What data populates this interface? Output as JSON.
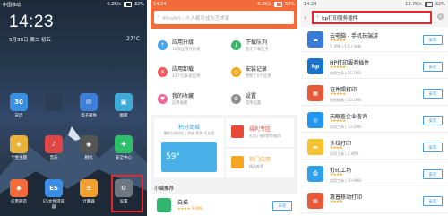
{
  "panel1": {
    "status": {
      "left": "中国移动",
      "right": "32%",
      "speed": "0.2K/s"
    },
    "clock": "14:23",
    "date": "5月30日 周二 初五",
    "temp": "27°C",
    "apps_row1": [
      {
        "label": "日历",
        "color": "#3a8fe0",
        "glyph": "30",
        "icon": "calendar-icon"
      },
      {
        "label": "",
        "color": "#2c3e55",
        "glyph": "",
        "icon": "app-icon"
      },
      {
        "label": "电子邮件",
        "color": "#3d7fd6",
        "glyph": "✉",
        "icon": "mail-icon"
      },
      {
        "label": "图库",
        "color": "#3fa9d8",
        "glyph": "▣",
        "icon": "gallery-icon"
      }
    ],
    "apps_row2": [
      {
        "label": "个性主题",
        "color": "#e9b23a",
        "glyph": "◈",
        "icon": "theme-icon"
      },
      {
        "label": "音乐",
        "color": "#e04646",
        "glyph": "♪",
        "icon": "music-icon"
      },
      {
        "label": "相机",
        "color": "#555555",
        "glyph": "◉",
        "icon": "camera-icon"
      },
      {
        "label": "安全中心",
        "color": "#2fbf6b",
        "glyph": "✚",
        "icon": "security-icon"
      }
    ],
    "dock": [
      {
        "label": "应用商店",
        "color": "#f26b3a",
        "glyph": "◆",
        "icon": "app-store-icon"
      },
      {
        "label": "ES文件浏览器",
        "color": "#3a8ee6",
        "glyph": "ES",
        "icon": "es-file-icon"
      },
      {
        "label": "计算器",
        "color": "#f0a030",
        "glyph": "±",
        "icon": "calculator-icon"
      },
      {
        "label": "设置",
        "color": "#6f7780",
        "glyph": "⚙",
        "icon": "settings-icon"
      }
    ]
  },
  "panel2": {
    "status": {
      "left": "14:24",
      "right": "33%",
      "speed": "0.2K/s"
    },
    "search_placeholder": "iPicsArt - 人人都可成为艺术家",
    "menu": [
      {
        "title": "应用升级",
        "sub": "16款应用待升级",
        "color": "#4aa3e8",
        "glyph": "↑",
        "icon": "upgrade-icon"
      },
      {
        "title": "下载队列",
        "sub": "暂无下载任务",
        "color": "#3fb26a",
        "glyph": "↓",
        "icon": "download-icon"
      },
      {
        "title": "应用卸载",
        "sub": "42个已安装应用",
        "color": "#f05a5a",
        "glyph": "✕",
        "icon": "uninstall-icon"
      },
      {
        "title": "安装记录",
        "sub": "更新了0个应用",
        "color": "#f5a623",
        "glyph": "◷",
        "icon": "history-icon"
      },
      {
        "title": "我的收藏",
        "sub": "应用收藏",
        "color": "#f0689c",
        "glyph": "♥",
        "icon": "favorite-icon"
      },
      {
        "title": "设置",
        "sub": "常用设置",
        "color": "#8e8e93",
        "glyph": "⚙",
        "icon": "settings-icon"
      }
    ],
    "promo1": {
      "title": "积分商城",
      "sub": "赚积分换好礼 | 完成\"签到\"可实现"
    },
    "promo2": {
      "title": "福利专区",
      "sub": "礼包 | 福利特别推荐"
    },
    "promo3": {
      "title": "热门应用",
      "sub": "精品推荐"
    },
    "promo_badge": "59°",
    "rec_title": "小编推荐",
    "rec_app": {
      "name": "白描",
      "meta": "★★★★ 9.4MB",
      "btn": "安装"
    }
  },
  "panel3": {
    "status": {
      "left": "14:24",
      "right": "32%",
      "speed": "13.7K/s"
    },
    "query": "hp打印服务插件",
    "results": [
      {
        "name": "云电脑 - 手机玩端游",
        "stars": "★★★★★",
        "meta": "5.1MB | 1万人安装",
        "color": "#3a7bd5",
        "glyph": "☁",
        "icon": "cloud-pc-icon",
        "btn": "安装"
      },
      {
        "name": "HP打印服务插件",
        "stars": "★★★★★",
        "meta": "实用工具 | 25.1MB",
        "color": "#1a73c7",
        "glyph": "hp",
        "icon": "hp-icon",
        "btn": "安装"
      },
      {
        "name": "证件照打印",
        "stars": "★★★★★",
        "meta": "拍照摄像 | 23.1MB",
        "color": "#e45a3a",
        "glyph": "▦",
        "icon": "id-photo-icon",
        "btn": "安装"
      },
      {
        "name": "天眼查企业查询",
        "stars": "★★★★★",
        "meta": "实用工具 | 13.2MB",
        "color": "#2196f3",
        "glyph": "◎",
        "icon": "tianyancha-icon",
        "btn": "安装"
      },
      {
        "name": "多拉打印",
        "stars": "★★★★",
        "meta": "实用工具 | 2.4MB",
        "color": "#f6c232",
        "glyph": "▬",
        "icon": "dola-icon",
        "btn": "安装"
      },
      {
        "name": "打印工场",
        "stars": "★★★★",
        "meta": "实用工具 | 30.8MB",
        "color": "#2ea1e8",
        "glyph": "⎙",
        "icon": "print-factory-icon",
        "btn": "安装"
      },
      {
        "name": "惠普移动打印",
        "stars": "★★★★",
        "meta": "",
        "color": "#e45a3a",
        "glyph": "▤",
        "icon": "hp-mobile-icon",
        "btn": "安装"
      }
    ]
  }
}
